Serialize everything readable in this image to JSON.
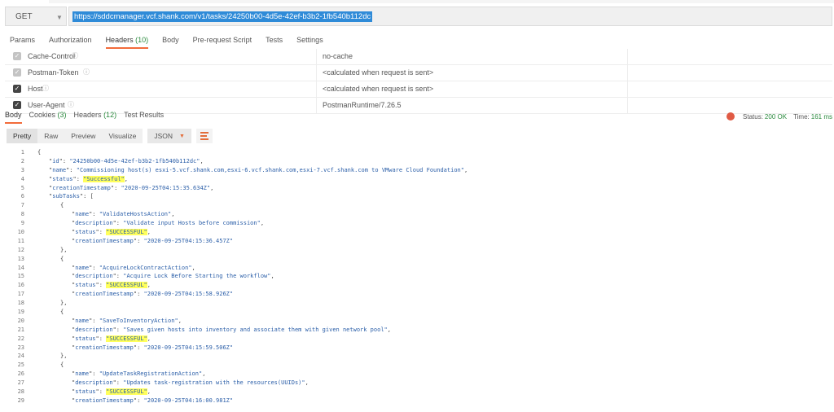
{
  "request": {
    "method": "GET",
    "url": "https://sddcmanager.vcf.shank.com/v1/tasks/24250b00-4d5e-42ef-b3b2-1fb540b112dc"
  },
  "request_tabs": [
    {
      "label": "Params",
      "count": ""
    },
    {
      "label": "Authorization",
      "count": ""
    },
    {
      "label": "Headers ",
      "count": "(10)"
    },
    {
      "label": "Body",
      "count": ""
    },
    {
      "label": "Pre-request Script",
      "count": ""
    },
    {
      "label": "Tests",
      "count": ""
    },
    {
      "label": "Settings",
      "count": ""
    }
  ],
  "headers": [
    {
      "key": "Cache-Control",
      "value": "no-cache",
      "checked": true
    },
    {
      "key": "Postman-Token",
      "value": "<calculated when request is sent>",
      "checked": true
    },
    {
      "key": "Host",
      "value": "<calculated when request is sent>",
      "checked": true
    },
    {
      "key": "User-Agent",
      "value": "PostmanRuntime/7.26.5",
      "checked": true
    }
  ],
  "response_tabs": [
    {
      "label": "Body",
      "count": ""
    },
    {
      "label": "Cookies ",
      "count": "(3)"
    },
    {
      "label": "Headers ",
      "count": "(12)"
    },
    {
      "label": "Test Results",
      "count": ""
    }
  ],
  "response_status": {
    "status_label": "Status:",
    "status_value": "200 OK",
    "time_label": "Time:",
    "time_value": "161 ms"
  },
  "view_buttons": [
    "Pretty",
    "Raw",
    "Preview",
    "Visualize"
  ],
  "format": "JSON",
  "json_lines": [
    {
      "n": 1,
      "i": 0,
      "t": "{",
      "f": true
    },
    {
      "n": 2,
      "i": 1,
      "k": "id",
      "v": "24250b00-4d5e-42ef-b3b2-1fb540b112dc",
      "c": ","
    },
    {
      "n": 3,
      "i": 1,
      "k": "name",
      "v": "Commissioning host(s) esxi-5.vcf.shank.com,esxi-6.vcf.shank.com,esxi-7.vcf.shank.com to VMware Cloud Foundation",
      "c": ","
    },
    {
      "n": 4,
      "i": 1,
      "k": "status",
      "v": "Successful",
      "c": ",",
      "h": true
    },
    {
      "n": 5,
      "i": 1,
      "k": "creationTimestamp",
      "v": "2020-09-25T04:15:35.634Z",
      "c": ","
    },
    {
      "n": 6,
      "i": 1,
      "k": "subTasks",
      "t": "["
    },
    {
      "n": 7,
      "i": 2,
      "t": "{"
    },
    {
      "n": 8,
      "i": 3,
      "k": "name",
      "v": "ValidateHostsAction",
      "c": ","
    },
    {
      "n": 9,
      "i": 3,
      "k": "description",
      "v": "Validate input Hosts before commission",
      "c": ","
    },
    {
      "n": 10,
      "i": 3,
      "k": "status",
      "v": "SUCCESSFUL",
      "c": ",",
      "h": true
    },
    {
      "n": 11,
      "i": 3,
      "k": "creationTimestamp",
      "v": "2020-09-25T04:15:36.457Z"
    },
    {
      "n": 12,
      "i": 2,
      "t": "},"
    },
    {
      "n": 13,
      "i": 2,
      "t": "{"
    },
    {
      "n": 14,
      "i": 3,
      "k": "name",
      "v": "AcquireLockContractAction",
      "c": ","
    },
    {
      "n": 15,
      "i": 3,
      "k": "description",
      "v": "Acquire Lock Before Starting the workflow",
      "c": ","
    },
    {
      "n": 16,
      "i": 3,
      "k": "status",
      "v": "SUCCESSFUL",
      "c": ",",
      "h": true
    },
    {
      "n": 17,
      "i": 3,
      "k": "creationTimestamp",
      "v": "2020-09-25T04:15:58.926Z"
    },
    {
      "n": 18,
      "i": 2,
      "t": "},"
    },
    {
      "n": 19,
      "i": 2,
      "t": "{"
    },
    {
      "n": 20,
      "i": 3,
      "k": "name",
      "v": "SaveToInventoryAction",
      "c": ","
    },
    {
      "n": 21,
      "i": 3,
      "k": "description",
      "v": "Saves given hosts into inventory and associate them with given network pool",
      "c": ","
    },
    {
      "n": 22,
      "i": 3,
      "k": "status",
      "v": "SUCCESSFUL",
      "c": ",",
      "h": true
    },
    {
      "n": 23,
      "i": 3,
      "k": "creationTimestamp",
      "v": "2020-09-25T04:15:59.506Z"
    },
    {
      "n": 24,
      "i": 2,
      "t": "},"
    },
    {
      "n": 25,
      "i": 2,
      "t": "{"
    },
    {
      "n": 26,
      "i": 3,
      "k": "name",
      "v": "UpdateTaskRegistrationAction",
      "c": ","
    },
    {
      "n": 27,
      "i": 3,
      "k": "description",
      "v": "Updates task-registration with the resources(UUIDs)",
      "c": ","
    },
    {
      "n": 28,
      "i": 3,
      "k": "status",
      "v": "SUCCESSFUL",
      "c": ",",
      "h": true
    },
    {
      "n": 29,
      "i": 3,
      "k": "creationTimestamp",
      "v": "2020-09-25T04:16:00.981Z"
    }
  ],
  "colors": {
    "accent": "#f26b3a",
    "status_ok": "#2b8a3e",
    "url_highlight": "#2f8bd8",
    "json_key": "#2a5ea8",
    "highlight": "#ffff5c"
  }
}
